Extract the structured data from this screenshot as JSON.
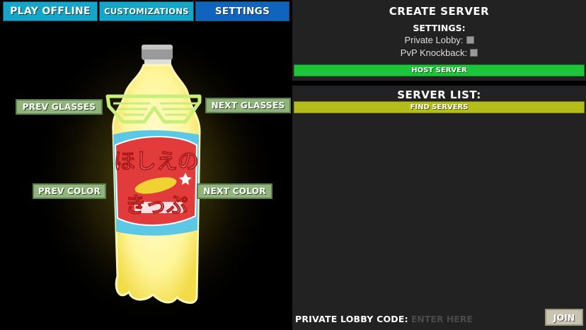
{
  "tabs": {
    "play_offline": "PLAY OFFLINE",
    "customizations": "CUSTOMIZATIONS",
    "settings": "SETTINGS"
  },
  "customize": {
    "prev_glasses": "PREV GLASSES",
    "next_glasses": "NEXT GLASSES",
    "prev_color": "PREV COLOR",
    "next_color": "NEXT COLOR",
    "bottle_label_text": "ほしえの きっぷ"
  },
  "create_server": {
    "title": "CREATE SERVER",
    "settings_label": "SETTINGS:",
    "private_lobby_label": "Private Lobby:",
    "private_lobby_checked": false,
    "pvp_knockback_label": "PvP Knockback:",
    "pvp_knockback_checked": false,
    "host_button": "HOST SERVER"
  },
  "server_list": {
    "title": "SERVER LIST:",
    "find_button": "FIND SERVERS",
    "servers": [],
    "code_label": "PRIVATE LOBBY CODE:",
    "code_value": "",
    "code_placeholder": "ENTER HERE",
    "join_button": "JOIN"
  },
  "colors": {
    "tab_active": "#1262c0",
    "tab_inactive": "#13a6c9",
    "host_green": "#1ec43a",
    "find_yellow": "#b4bd1a",
    "chip_green": "#8fb57a",
    "bottle_glow": "#fff8a8",
    "glasses_green": "#c8ef7a"
  }
}
